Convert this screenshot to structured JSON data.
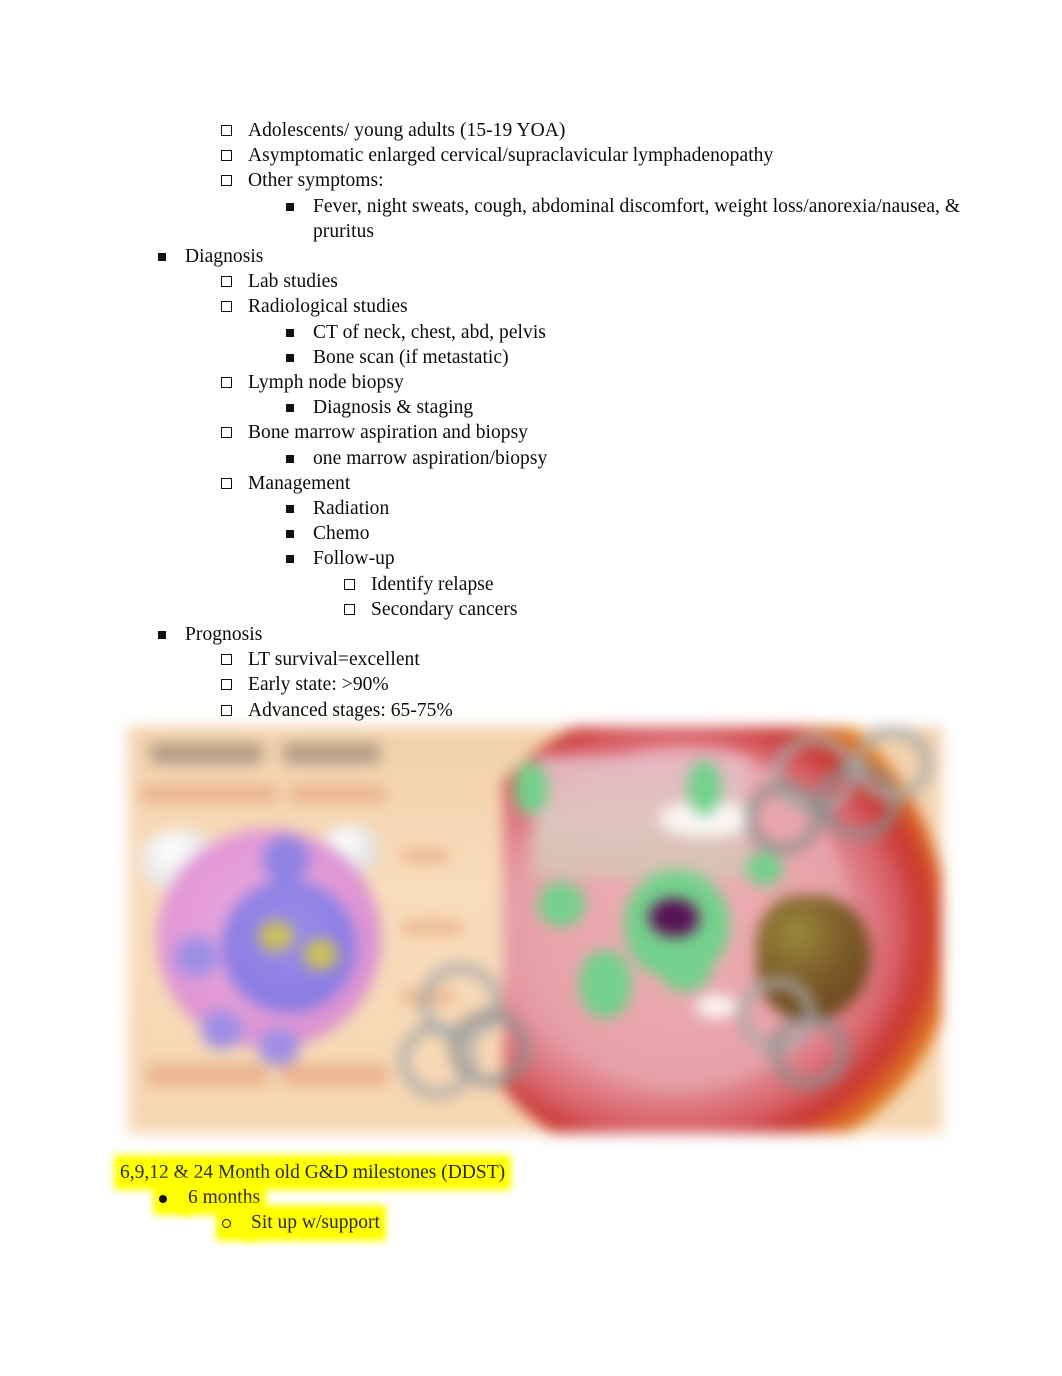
{
  "document": {
    "outline": [
      {
        "level": 2,
        "marker": "hollow-square",
        "text": "Adolescents/ young adults (15-19 YOA)"
      },
      {
        "level": 2,
        "marker": "hollow-square",
        "text": "Asymptomatic enlarged cervical/supraclavicular lymphadenopathy"
      },
      {
        "level": 2,
        "marker": "hollow-square",
        "text": "Other symptoms:"
      },
      {
        "level": 3,
        "marker": "filled-square",
        "text": "Fever, night sweats, cough, abdominal discomfort, weight loss/anorexia/nausea, & pruritus"
      },
      {
        "level": 1,
        "marker": "filled-square",
        "text": "Diagnosis"
      },
      {
        "level": 2,
        "marker": "hollow-square",
        "text": "Lab studies"
      },
      {
        "level": 2,
        "marker": "hollow-square",
        "text": "Radiological studies"
      },
      {
        "level": 3,
        "marker": "filled-square",
        "text": "CT of neck, chest, abd, pelvis"
      },
      {
        "level": 3,
        "marker": "filled-square",
        "text": "Bone scan (if metastatic)"
      },
      {
        "level": 2,
        "marker": "hollow-square",
        "text": "Lymph node biopsy"
      },
      {
        "level": 3,
        "marker": "filled-square",
        "text": "Diagnosis & staging"
      },
      {
        "level": 2,
        "marker": "hollow-square",
        "text": "Bone marrow aspiration and biopsy"
      },
      {
        "level": 3,
        "marker": "filled-square",
        "text": "one marrow aspiration/biopsy"
      },
      {
        "level": 2,
        "marker": "hollow-square",
        "text": "Management"
      },
      {
        "level": 3,
        "marker": "filled-square",
        "text": "Radiation"
      },
      {
        "level": 3,
        "marker": "filled-square",
        "text": "Chemo"
      },
      {
        "level": 3,
        "marker": "filled-square",
        "text": "Follow-up"
      },
      {
        "level": 4,
        "marker": "hollow-square",
        "text": "Identify relapse"
      },
      {
        "level": 4,
        "marker": "hollow-square",
        "text": "Secondary cancers"
      },
      {
        "level": 1,
        "marker": "filled-square",
        "text": "Prognosis"
      },
      {
        "level": 2,
        "marker": "hollow-square",
        "text": "LT survival=excellent"
      },
      {
        "level": 2,
        "marker": "hollow-square",
        "text": "Early state: >90%"
      },
      {
        "level": 2,
        "marker": "hollow-square",
        "text": "Advanced stages: 65-75%"
      }
    ],
    "figure": {
      "alt": "Blurred medical illustration: lymphoma cell diagram on peach background with anatomical chest/abdomen cross-section showing lymph nodes",
      "colors": {
        "background": "#f2d0ac",
        "cell_outer": "#e39bd8",
        "cell_inner": "#8c7ee4",
        "tissue_pink": "#e8a3a9",
        "lymph_green": "#74d18c",
        "node_purple": "#611a5c",
        "liver_brown": "#7c5a28",
        "band_red": "#c8352f",
        "band_yellow": "#f0b519",
        "chain_grey": "#a9a9a9"
      }
    },
    "highlighted_section": {
      "highlight_color": "#ffff00",
      "items": [
        {
          "level": 0,
          "marker": "none",
          "text": "6,9,12 & 24 Month old G&D milestones (DDST)"
        },
        {
          "level": 1,
          "marker": "disc",
          "text": "6 months"
        },
        {
          "level": 2,
          "marker": "hollow-circle",
          "text": "Sit up w/support"
        }
      ]
    }
  }
}
